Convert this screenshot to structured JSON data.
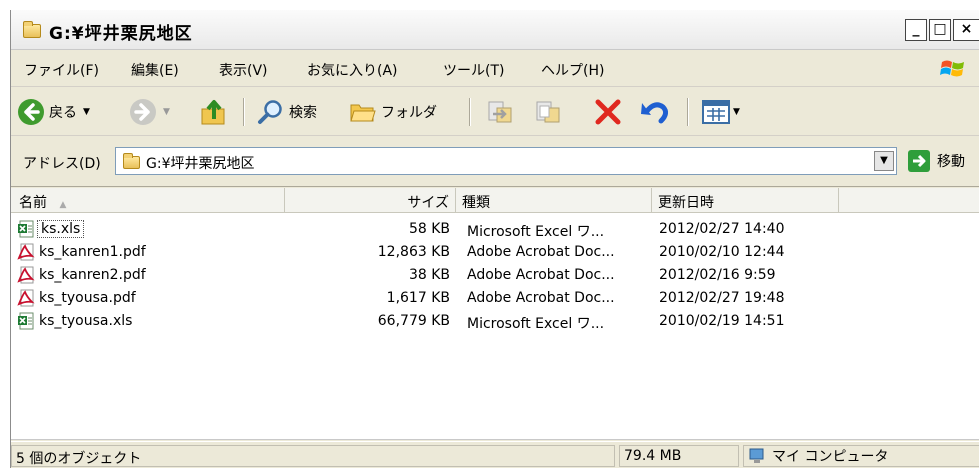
{
  "window": {
    "title": "G:¥坪井栗尻地区",
    "controls": {
      "minimize": "_",
      "maximize": "□",
      "close": "×"
    }
  },
  "menubar": {
    "items": [
      "ファイル(F)",
      "編集(E)",
      "表示(V)",
      "お気に入り(A)",
      "ツール(T)",
      "ヘルプ(H)"
    ]
  },
  "toolbar": {
    "back_label": "戻る",
    "search_label": "検索",
    "folders_label": "フォルダ"
  },
  "address": {
    "label": "アドレス(D)",
    "value": "G:¥坪井栗尻地区",
    "go_label": "移動"
  },
  "list": {
    "columns": [
      "名前",
      "サイズ",
      "種類",
      "更新日時"
    ],
    "rows": [
      {
        "name": "ks.xls",
        "size": "58 KB",
        "type": "Microsoft Excel ワ...",
        "modified": "2012/02/27 14:40",
        "icon": "excel-icon"
      },
      {
        "name": "ks_kanren1.pdf",
        "size": "12,863 KB",
        "type": "Adobe Acrobat Doc...",
        "modified": "2010/02/10 12:44",
        "icon": "pdf-icon"
      },
      {
        "name": "ks_kanren2.pdf",
        "size": "38 KB",
        "type": "Adobe Acrobat Doc...",
        "modified": "2012/02/16 9:59",
        "icon": "pdf-icon"
      },
      {
        "name": "ks_tyousa.pdf",
        "size": "1,617 KB",
        "type": "Adobe Acrobat Doc...",
        "modified": "2012/02/27 19:48",
        "icon": "pdf-icon"
      },
      {
        "name": "ks_tyousa.xls",
        "size": "66,779 KB",
        "type": "Microsoft Excel ワ...",
        "modified": "2010/02/19 14:51",
        "icon": "excel-icon"
      }
    ]
  },
  "status": {
    "object_count": "5 個のオブジェクト",
    "total_size": "79.4 MB",
    "location": "マイ コンピュータ"
  },
  "colors": {
    "window_bg": "#ece9d8",
    "excel_green": "#1e7b34",
    "pdf_red": "#c8102e",
    "delete_red": "#e0281f",
    "undo_blue": "#1f5fd1",
    "go_green": "#2f9e3b"
  }
}
